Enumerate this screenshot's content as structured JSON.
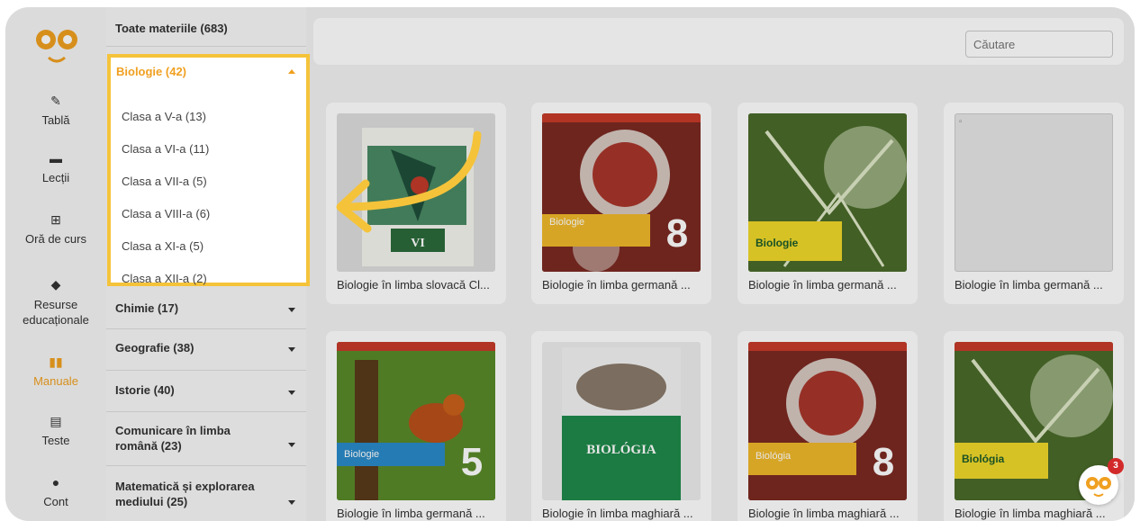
{
  "rail": {
    "items": [
      {
        "label": "Tablă",
        "icon": "pencil-icon"
      },
      {
        "label": "Lecții",
        "icon": "folder-icon"
      },
      {
        "label": "Oră de curs",
        "icon": "teacher-icon"
      },
      {
        "label": "Resurse educaționale",
        "icon": "cube-icon"
      },
      {
        "label": "Manuale",
        "icon": "book-icon"
      },
      {
        "label": "Teste",
        "icon": "document-icon"
      },
      {
        "label": "Cont",
        "icon": "user-icon"
      }
    ],
    "active": "Manuale",
    "accent": "#f0a020"
  },
  "subjects": {
    "all": "Toate materiile (683)",
    "expanded": "Biologie (42)",
    "grades": [
      "Clasa a V-a (13)",
      "Clasa a VI-a (11)",
      "Clasa a VII-a (5)",
      "Clasa a VIII-a (6)",
      "Clasa a XI-a (5)",
      "Clasa a XII-a (2)"
    ],
    "others": [
      "Chimie (17)",
      "Geografie (38)",
      "Istorie (40)",
      "Comunicare în limba română (23)",
      "Matematică și explorarea mediului (25)"
    ]
  },
  "search": {
    "placeholder": "Căutare"
  },
  "books": [
    {
      "title": "Biologie în limba slovacă Cl..."
    },
    {
      "title": "Biologie în limba germană ..."
    },
    {
      "title": "Biologie în limba germană ..."
    },
    {
      "title": "Biologie în limba germană ..."
    },
    {
      "title": "Biologie în limba germană ..."
    },
    {
      "title": "Biologie în limba maghiară ..."
    },
    {
      "title": "Biologie în limba maghiară ..."
    },
    {
      "title": "Biologie în limba maghiară ..."
    }
  ],
  "help": {
    "badge": "3"
  },
  "highlight_color": "#f5c33a"
}
